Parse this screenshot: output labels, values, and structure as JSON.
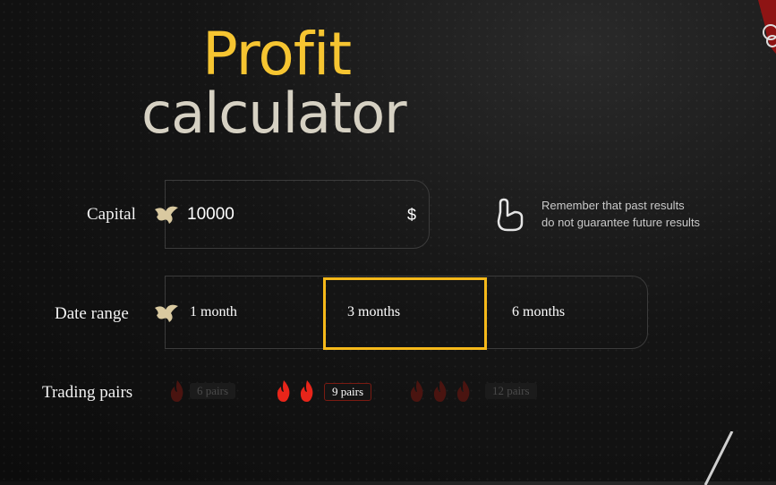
{
  "title": {
    "line1": "Profit",
    "line2": "calculator"
  },
  "capital": {
    "label": "Capital",
    "value": "10000",
    "currency": "$"
  },
  "hint": {
    "line1": "Remember that past results",
    "line2": "do not guarantee future results"
  },
  "date_range": {
    "label": "Date range",
    "options": [
      "1 month",
      "3 months",
      "6 months"
    ],
    "selected": "3 months"
  },
  "trading_pairs": {
    "label": "Trading pairs",
    "options": [
      "6 pairs",
      "9 pairs",
      "12 pairs"
    ],
    "selected": "9 pairs"
  },
  "colors": {
    "accent": "#f6c531",
    "selected_border": "#f6b91a",
    "flame_active": "#e8251a",
    "flame_dim": "#4a1410"
  },
  "icons": [
    "emblem-icon",
    "hand-pointer-icon",
    "flame-icon"
  ]
}
